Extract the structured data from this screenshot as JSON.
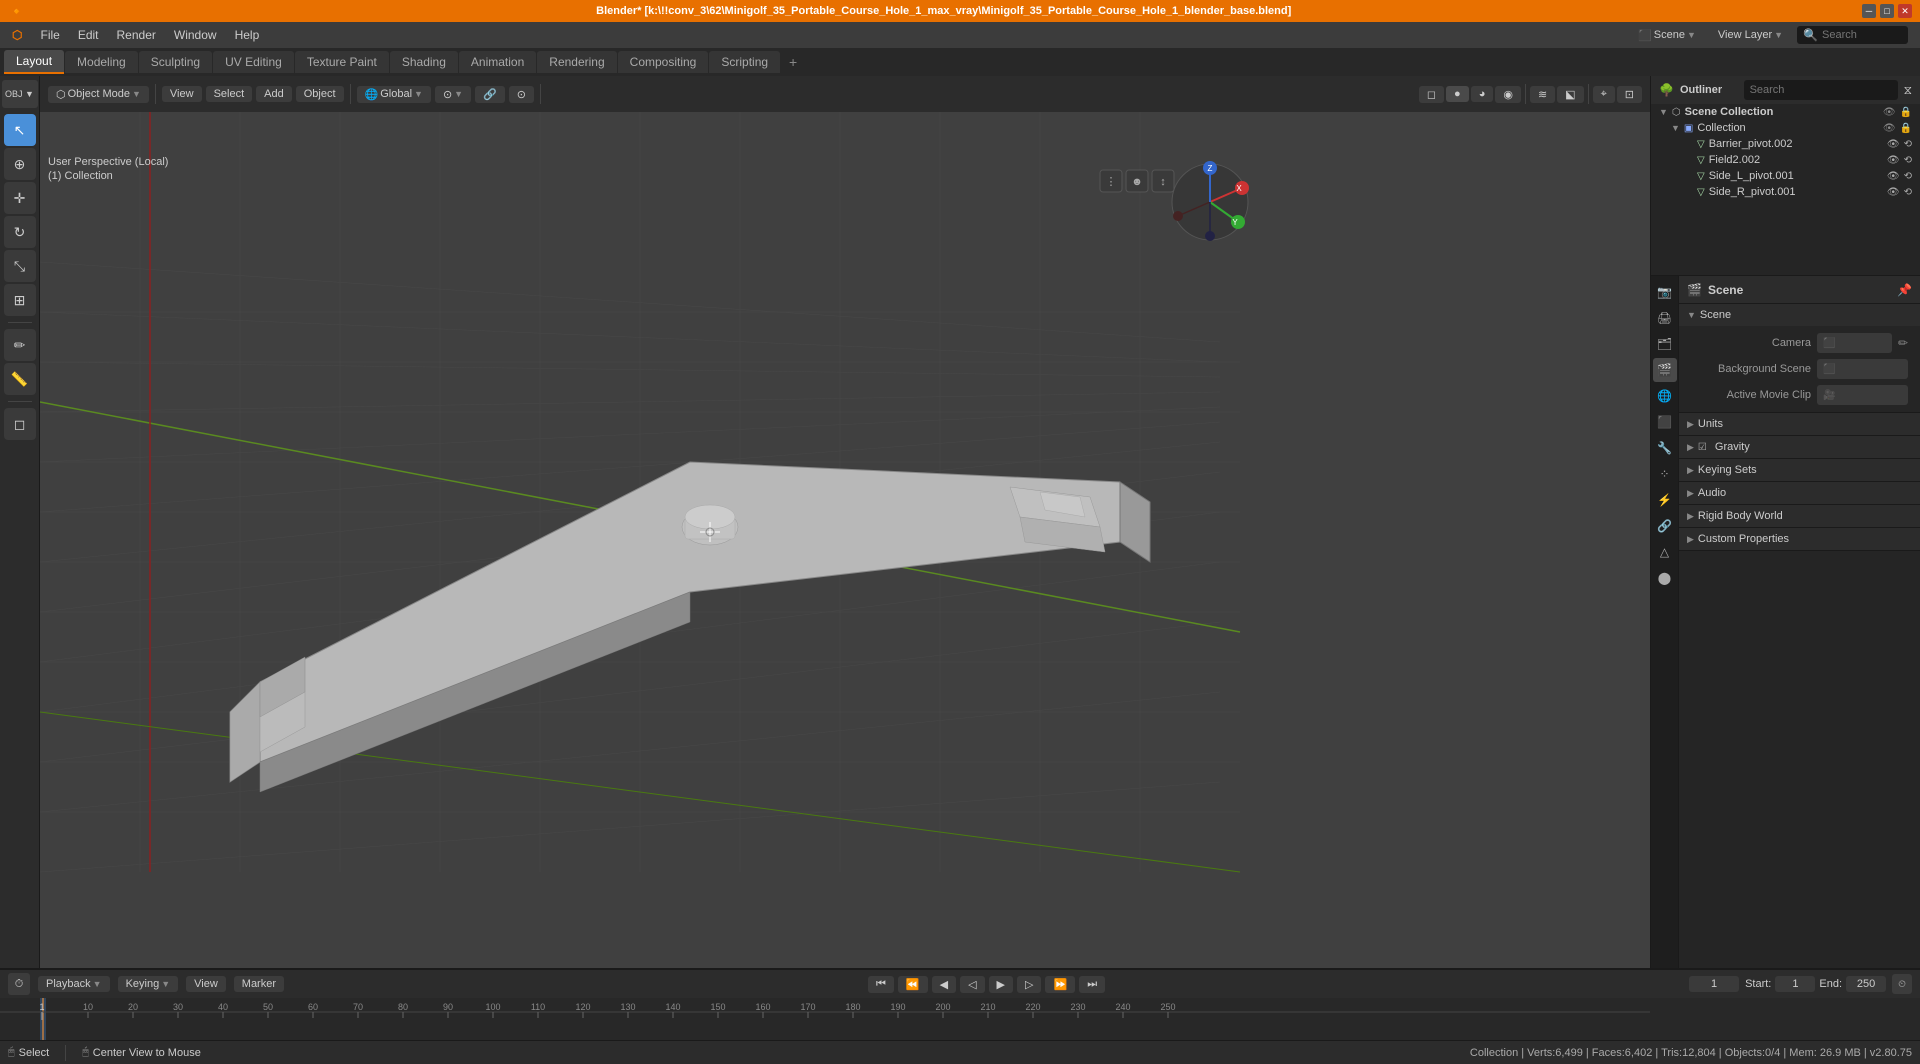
{
  "window": {
    "title": "Blender* [k:\\!!conv_3\\62\\Minigolf_35_Portable_Course_Hole_1_max_vray\\Minigolf_35_Portable_Course_Hole_1_blender_base.blend]"
  },
  "menu": {
    "items": [
      "Blender",
      "File",
      "Edit",
      "Render",
      "Window",
      "Help"
    ]
  },
  "workspaces": {
    "tabs": [
      "Layout",
      "Modeling",
      "Sculpting",
      "UV Editing",
      "Texture Paint",
      "Shading",
      "Animation",
      "Rendering",
      "Compositing",
      "Scripting",
      "+"
    ],
    "active": "Layout"
  },
  "viewport": {
    "mode": "Object Mode",
    "view": "User Perspective (Local)",
    "collection": "(1) Collection",
    "transform": "Global",
    "snapping": "",
    "overlay_label": "Overlay",
    "header_right": "Scene",
    "header_right2": "View Layer"
  },
  "outliner": {
    "title": "Outliner",
    "items": [
      {
        "level": 0,
        "name": "Scene Collection",
        "icon": "📁",
        "type": "collection"
      },
      {
        "level": 1,
        "name": "Collection",
        "icon": "📁",
        "type": "collection"
      },
      {
        "level": 2,
        "name": "Barrier_pivot.002",
        "icon": "▽",
        "type": "object"
      },
      {
        "level": 2,
        "name": "Field2.002",
        "icon": "▽",
        "type": "object"
      },
      {
        "level": 2,
        "name": "Side_L_pivot.001",
        "icon": "▽",
        "type": "object"
      },
      {
        "level": 2,
        "name": "Side_R_pivot.001",
        "icon": "▽",
        "type": "object"
      }
    ]
  },
  "properties": {
    "title": "Scene",
    "icon": "scene-icon",
    "sections": [
      {
        "id": "scene",
        "label": "Scene",
        "expanded": true,
        "rows": [
          {
            "label": "Camera",
            "value": ""
          },
          {
            "label": "Background Scene",
            "value": ""
          },
          {
            "label": "Active Movie Clip",
            "value": ""
          }
        ]
      },
      {
        "id": "units",
        "label": "Units",
        "expanded": false,
        "rows": []
      },
      {
        "id": "gravity",
        "label": "Gravity",
        "expanded": false,
        "rows": []
      },
      {
        "id": "keying-sets",
        "label": "Keying Sets",
        "expanded": false,
        "rows": []
      },
      {
        "id": "audio",
        "label": "Audio",
        "expanded": false,
        "rows": []
      },
      {
        "id": "rigid-body-world",
        "label": "Rigid Body World",
        "expanded": false,
        "rows": []
      },
      {
        "id": "custom-properties",
        "label": "Custom Properties",
        "expanded": false,
        "rows": []
      }
    ],
    "sidebar_icons": [
      "render",
      "output",
      "view-layer",
      "scene",
      "world",
      "object",
      "modifier",
      "particles",
      "physics",
      "constraints",
      "data",
      "material",
      "shaderfx"
    ]
  },
  "timeline": {
    "playback_label": "Playback",
    "keying_label": "Keying",
    "view_label": "View",
    "marker_label": "Marker",
    "frame_current": "1",
    "frame_start_label": "Start:",
    "frame_start": "1",
    "frame_end_label": "End:",
    "frame_end": "250",
    "ruler_marks": [
      "1",
      "10",
      "20",
      "30",
      "40",
      "50",
      "60",
      "70",
      "80",
      "90",
      "100",
      "110",
      "120",
      "130",
      "140",
      "150",
      "160",
      "170",
      "180",
      "190",
      "200",
      "210",
      "220",
      "230",
      "240",
      "250"
    ]
  },
  "status_bar": {
    "select_label": "Select",
    "center_view_label": "Center View to Mouse",
    "stats": "Collection | Verts:6,499 | Faces:6,402 | Tris:12,804 | Objects:0/4 | Mem: 26.9 MB | v2.80.75"
  },
  "colors": {
    "accent": "#e87000",
    "active_blue": "#4a90d9",
    "bg_dark": "#1a1a1a",
    "bg_medium": "#2c2c2c",
    "bg_light": "#3c3c3c"
  }
}
